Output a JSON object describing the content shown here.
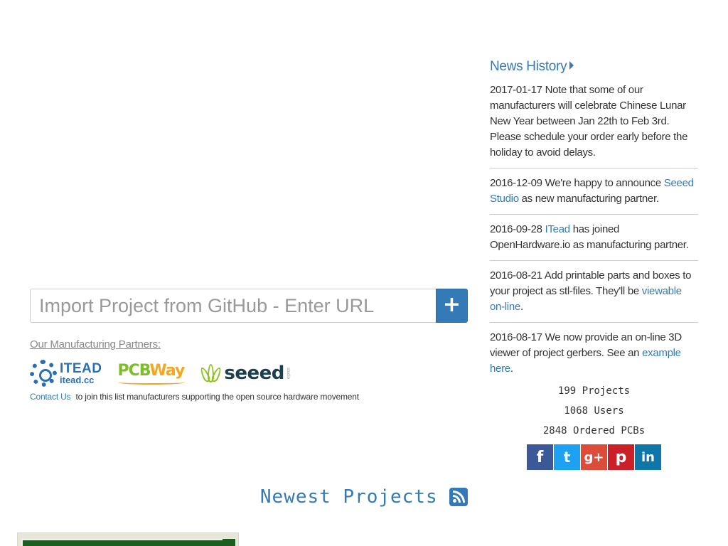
{
  "import": {
    "placeholder": "Import Project from GitHub - Enter URL",
    "button_icon": "plus-icon"
  },
  "partners": {
    "heading": "Our Manufacturing Partners:",
    "logos": [
      {
        "name": "ITEAD",
        "sub": "itead.cc"
      },
      {
        "name_part1": "PCB",
        "name_part2": "Way"
      },
      {
        "name": "seeed",
        "sub": "studio"
      }
    ],
    "contact_link": "Contact Us",
    "contact_text": "to join this list manufacturers supporting the open source hardware movement"
  },
  "news": {
    "title": "News History",
    "items": [
      {
        "date": "2017-01-17",
        "text": "Note that some of our manufacturers will celebrate Chinese Lunar New Year between Jan 22th to Feb 3rd. Please schedule your order early before the holiday to avoid delays."
      },
      {
        "date": "2016-12-09",
        "before": "We're happy to announce",
        "link": "Seeed Studio",
        "after": "as new manufacturing partner."
      },
      {
        "date": "2016-09-28",
        "link": "ITead",
        "after": "has joined OpenHardware.io as manufacturing partner."
      },
      {
        "date": "2016-08-21",
        "before": "Add printable parts and boxes to your project as stl-files. They'll be",
        "link": "viewable on-line",
        "after": "."
      },
      {
        "date": "2016-08-17",
        "before": "We now provide an on-line 3D viewer of project gerbers. See an",
        "link": "example here",
        "after": "."
      }
    ]
  },
  "stats": {
    "projects": "199 Projects",
    "users": "1068 Users",
    "pcbs": "2848 Ordered PCBs"
  },
  "social": {
    "facebook": "f",
    "twitter": "t",
    "googleplus": "g+",
    "pinterest": "p",
    "linkedin": "in"
  },
  "newest": {
    "title": "Newest Projects"
  },
  "colors": {
    "accent": "#337ab7",
    "facebook": "#3b5998",
    "twitter": "#1da1f2",
    "googleplus": "#dd4b39",
    "pinterest": "#cb2027",
    "linkedin": "#0e76a8"
  }
}
